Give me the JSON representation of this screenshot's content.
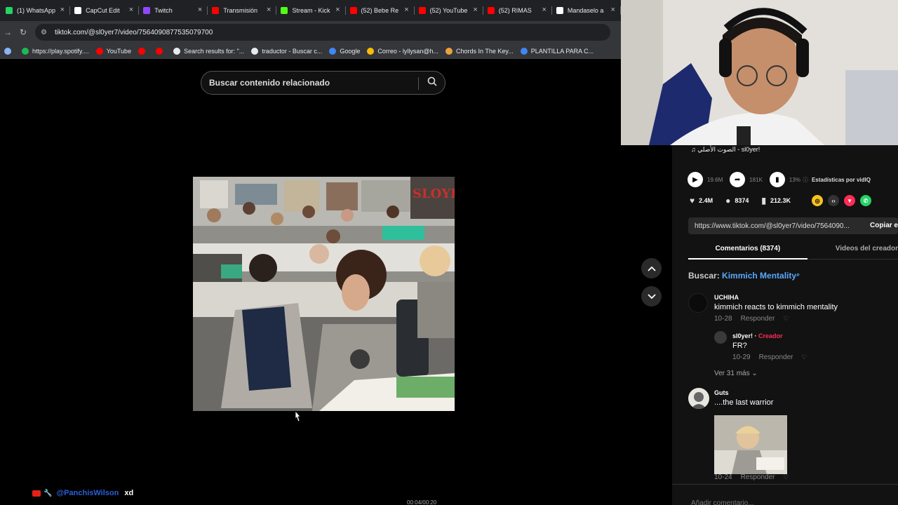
{
  "browser": {
    "tabs": [
      {
        "title": "(1) WhatsApp",
        "color": "#25d366"
      },
      {
        "title": "CapCut Edit",
        "color": "#ffffff"
      },
      {
        "title": "Twitch",
        "color": "#9146ff"
      },
      {
        "title": "Transmisión",
        "color": "#ff0000"
      },
      {
        "title": "Stream - Kick",
        "color": "#53fc18"
      },
      {
        "title": "(52) Bebe Re",
        "color": "#ff0000"
      },
      {
        "title": "(52) YouTube",
        "color": "#ff0000"
      },
      {
        "title": "(52) RIMAS",
        "color": "#ff0000"
      },
      {
        "title": "Mandaselo a",
        "color": "#ffffff"
      }
    ],
    "close_glyph": "×",
    "url": "tiktok.com/@sl0yer7/video/7564090877535079700",
    "bookmarks": [
      {
        "label": "",
        "color": "#8ab4f8"
      },
      {
        "label": "https://play.spotify....",
        "color": "#1db954"
      },
      {
        "label": "YouTube",
        "color": "#ff0000"
      },
      {
        "label": "",
        "color": "#ff0000"
      },
      {
        "label": "",
        "color": "#ff0000"
      },
      {
        "label": "Search results for: \"...",
        "color": "#e8eaed"
      },
      {
        "label": "traductor - Buscar c...",
        "color": "#e8eaed"
      },
      {
        "label": "Google",
        "color": "#4285f4"
      },
      {
        "label": "Correo - lyllysan@h...",
        "color": "#fbbc04"
      },
      {
        "label": "Chords In The Key...",
        "color": "#e8a33d"
      },
      {
        "label": "PLANTILLA PARA C...",
        "color": "#4285f4"
      }
    ]
  },
  "main": {
    "search_placeholder": "Buscar contenido relacionado",
    "video_watermark": "SLOYER"
  },
  "overlay": {
    "chat_user": "@PanchisWilson",
    "chat_message": "xd",
    "timecode": "00:04/00:20"
  },
  "panel": {
    "music": "♫ الصوت الأصلي - sl0yer!",
    "views": "19.6M",
    "shares": "181K",
    "stat_pct": "13%",
    "stats_label": "Estadísticas por vidIQ",
    "likes": "2.4M",
    "comments_count": "8374",
    "saves": "212.3K",
    "share_url": "https://www.tiktok.com/@sl0yer7/video/7564090...",
    "copy_label": "Copiar e",
    "tab_comments": "Comentarios (8374)",
    "tab_creator": "Videos del creador",
    "search_prefix": "Buscar:",
    "search_query": "Kimmich Mentality",
    "comments": [
      {
        "user": "UCHIHA",
        "text": "kimmich reacts to kimmich mentality",
        "date": "10-28",
        "reply": "Responder"
      },
      {
        "user": "sl0yer!",
        "badge": "Creador",
        "text": "FR?",
        "date": "10-29",
        "reply": "Responder"
      },
      {
        "user": "Guts",
        "text": "....the last warrior",
        "date": "10-24",
        "reply": "Responder"
      }
    ],
    "more_replies": "Ver 31 más",
    "add_comment": "Añadir comentario..."
  }
}
